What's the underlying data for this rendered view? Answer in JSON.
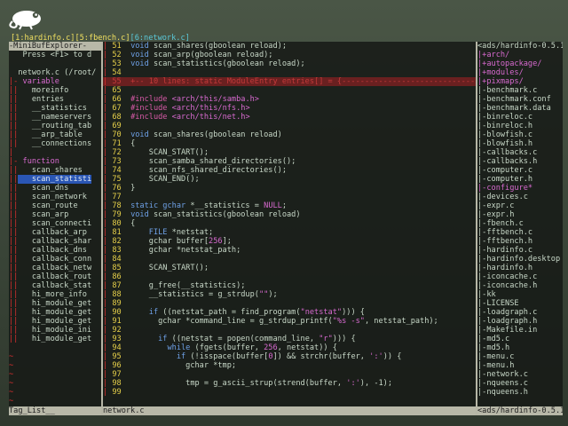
{
  "buffer_tabs": {
    "items": [
      "[1:hardinfo.c]",
      "[5:fbench.c]",
      "[6:network.c]"
    ]
  },
  "left_pane": {
    "title": "-MiniBufExplorer-",
    "lines": [
      {
        "gut": "",
        "text": " Press <F1> to d",
        "cls": "txt"
      },
      {
        "gut": "",
        "text": "",
        "cls": "txt"
      },
      {
        "gut": "",
        "text": "network.c (/root/",
        "cls": "txt"
      },
      {
        "gut": "|-",
        "text": " variable",
        "cls": "magenta"
      },
      {
        "gut": "||",
        "text": "   moreinfo",
        "cls": "txt"
      },
      {
        "gut": "||",
        "text": "   entries",
        "cls": "txt"
      },
      {
        "gut": "||",
        "text": "   __statistics",
        "cls": "txt"
      },
      {
        "gut": "||",
        "text": "   __nameservers",
        "cls": "txt"
      },
      {
        "gut": "||",
        "text": "   __routing_tab",
        "cls": "txt"
      },
      {
        "gut": "||",
        "text": "   __arp_table",
        "cls": "txt"
      },
      {
        "gut": "||",
        "text": "   __connections",
        "cls": "txt"
      },
      {
        "gut": "|",
        "text": "",
        "cls": "txt"
      },
      {
        "gut": "|-",
        "text": " function",
        "cls": "magenta"
      },
      {
        "gut": "||",
        "text": "   scan_shares",
        "cls": "txt"
      },
      {
        "gut": "||",
        "text": "   scan_statisti",
        "cls": "sel"
      },
      {
        "gut": "||",
        "text": "   scan_dns",
        "cls": "txt"
      },
      {
        "gut": "||",
        "text": "   scan_network",
        "cls": "txt"
      },
      {
        "gut": "||",
        "text": "   scan_route",
        "cls": "txt"
      },
      {
        "gut": "||",
        "text": "   scan_arp",
        "cls": "txt"
      },
      {
        "gut": "||",
        "text": "   scan_connecti",
        "cls": "txt"
      },
      {
        "gut": "||",
        "text": "   callback_arp",
        "cls": "txt"
      },
      {
        "gut": "||",
        "text": "   callback_shar",
        "cls": "txt"
      },
      {
        "gut": "||",
        "text": "   callback_dns",
        "cls": "txt"
      },
      {
        "gut": "||",
        "text": "   callback_conn",
        "cls": "txt"
      },
      {
        "gut": "||",
        "text": "   callback_netw",
        "cls": "txt"
      },
      {
        "gut": "||",
        "text": "   callback_rout",
        "cls": "txt"
      },
      {
        "gut": "||",
        "text": "   callback_stat",
        "cls": "txt"
      },
      {
        "gut": "||",
        "text": "   hi_more_info",
        "cls": "txt"
      },
      {
        "gut": "||",
        "text": "   hi_module_get",
        "cls": "txt"
      },
      {
        "gut": "||",
        "text": "   hi_module_get",
        "cls": "txt"
      },
      {
        "gut": "||",
        "text": "   hi_module_get",
        "cls": "txt"
      },
      {
        "gut": "||",
        "text": "   hi_module_ini",
        "cls": "txt"
      },
      {
        "gut": "||",
        "text": "   hi_module_get",
        "cls": "txt"
      },
      {
        "gut": "",
        "text": "",
        "cls": "txt"
      },
      {
        "gut": "~",
        "text": "",
        "cls": "txt"
      },
      {
        "gut": "~",
        "text": "",
        "cls": "txt"
      },
      {
        "gut": "~",
        "text": "",
        "cls": "txt"
      },
      {
        "gut": "~",
        "text": "",
        "cls": "txt"
      },
      {
        "gut": "~",
        "text": "",
        "cls": "txt"
      },
      {
        "gut": "~",
        "text": "",
        "cls": "txt"
      },
      {
        "gut": "~",
        "text": "",
        "cls": "txt"
      }
    ],
    "status": "Tag_List__"
  },
  "code_pane": {
    "lines": [
      {
        "n": "51",
        "segs": [
          [
            "kw",
            "void "
          ],
          [
            "txt",
            "scan_shares(gboolean reload);"
          ]
        ]
      },
      {
        "n": "52",
        "segs": [
          [
            "kw",
            "void "
          ],
          [
            "txt",
            "scan_arp(gboolean reload);"
          ]
        ]
      },
      {
        "n": "53",
        "segs": [
          [
            "kw",
            "void "
          ],
          [
            "txt",
            "scan_statistics(gboolean reload);"
          ]
        ]
      },
      {
        "n": "54",
        "segs": []
      },
      {
        "n": "55",
        "segs": [
          [
            "red",
            "+-- 10 lines: static ModuleEntry entries[] = {-------------------------------------------"
          ]
        ],
        "fold": true
      },
      {
        "n": "65",
        "segs": []
      },
      {
        "n": "66",
        "segs": [
          [
            "pp",
            "#include "
          ],
          [
            "inc",
            "<arch/this/samba.h>"
          ]
        ]
      },
      {
        "n": "67",
        "segs": [
          [
            "pp",
            "#include "
          ],
          [
            "inc",
            "<arch/this/nfs.h>"
          ]
        ]
      },
      {
        "n": "68",
        "segs": [
          [
            "pp",
            "#include "
          ],
          [
            "inc",
            "<arch/this/net.h>"
          ]
        ]
      },
      {
        "n": "69",
        "segs": []
      },
      {
        "n": "70",
        "segs": [
          [
            "kw",
            "void "
          ],
          [
            "txt",
            "scan_shares(gboolean reload)"
          ]
        ]
      },
      {
        "n": "71",
        "segs": [
          [
            "txt",
            "{"
          ]
        ]
      },
      {
        "n": "72",
        "segs": [
          [
            "txt",
            "    SCAN_START();"
          ]
        ]
      },
      {
        "n": "73",
        "segs": [
          [
            "txt",
            "    scan_samba_shared_directories();"
          ]
        ]
      },
      {
        "n": "74",
        "segs": [
          [
            "txt",
            "    scan_nfs_shared_directories();"
          ]
        ]
      },
      {
        "n": "75",
        "segs": [
          [
            "txt",
            "    SCAN_END();"
          ]
        ]
      },
      {
        "n": "76",
        "segs": [
          [
            "txt",
            "}"
          ]
        ]
      },
      {
        "n": "77",
        "segs": []
      },
      {
        "n": "78",
        "segs": [
          [
            "kw",
            "static "
          ],
          [
            "kw",
            "gchar "
          ],
          [
            "txt",
            "*__statistics = "
          ],
          [
            "num",
            "NULL"
          ],
          [
            "txt",
            ";"
          ]
        ]
      },
      {
        "n": "79",
        "segs": [
          [
            "kw",
            "void "
          ],
          [
            "txt",
            "scan_statistics(gboolean reload)"
          ]
        ]
      },
      {
        "n": "80",
        "segs": [
          [
            "txt",
            "{"
          ]
        ]
      },
      {
        "n": "81",
        "segs": [
          [
            "kw",
            "    FILE "
          ],
          [
            "txt",
            "*netstat;"
          ]
        ]
      },
      {
        "n": "82",
        "segs": [
          [
            "txt",
            "    gchar buffer["
          ],
          [
            "num",
            "256"
          ],
          [
            "txt",
            "];"
          ]
        ]
      },
      {
        "n": "83",
        "segs": [
          [
            "txt",
            "    gchar *netstat_path;"
          ]
        ]
      },
      {
        "n": "84",
        "segs": []
      },
      {
        "n": "85",
        "segs": [
          [
            "txt",
            "    SCAN_START();"
          ]
        ]
      },
      {
        "n": "86",
        "segs": []
      },
      {
        "n": "87",
        "segs": [
          [
            "txt",
            "    g_free(__statistics);"
          ]
        ]
      },
      {
        "n": "88",
        "segs": [
          [
            "txt",
            "    __statistics = g_strdup("
          ],
          [
            "str",
            "\"\""
          ],
          [
            "txt",
            ");"
          ]
        ]
      },
      {
        "n": "89",
        "segs": []
      },
      {
        "n": "90",
        "segs": [
          [
            "kw",
            "    if "
          ],
          [
            "txt",
            "((netstat_path = find_program("
          ],
          [
            "str",
            "\"netstat\""
          ],
          [
            "txt",
            "))) {"
          ]
        ]
      },
      {
        "n": "91",
        "segs": [
          [
            "txt",
            "      gchar *command_line = g_strdup_printf("
          ],
          [
            "str",
            "\"%s -s\""
          ],
          [
            "txt",
            ", netstat_path);"
          ]
        ]
      },
      {
        "n": "92",
        "segs": []
      },
      {
        "n": "93",
        "segs": [
          [
            "kw",
            "      if "
          ],
          [
            "txt",
            "((netstat = popen(command_line, "
          ],
          [
            "str",
            "\"r\""
          ],
          [
            "txt",
            "))) {"
          ]
        ]
      },
      {
        "n": "94",
        "segs": [
          [
            "kw",
            "        while "
          ],
          [
            "txt",
            "(fgets(buffer, "
          ],
          [
            "num",
            "256"
          ],
          [
            "txt",
            ", netstat)) {"
          ]
        ]
      },
      {
        "n": "95",
        "segs": [
          [
            "kw",
            "          if "
          ],
          [
            "txt",
            "(!isspace(buffer["
          ],
          [
            "num",
            "0"
          ],
          [
            "txt",
            "]) && strchr(buffer, "
          ],
          [
            "str",
            "':'"
          ],
          [
            "txt",
            ")) {"
          ]
        ]
      },
      {
        "n": "96",
        "segs": [
          [
            "txt",
            "            gchar *tmp;"
          ]
        ]
      },
      {
        "n": "97",
        "segs": []
      },
      {
        "n": "98",
        "segs": [
          [
            "txt",
            "            tmp = g_ascii_strup(strend(buffer, "
          ],
          [
            "str",
            "':'"
          ],
          [
            "txt",
            "), -1);"
          ]
        ]
      },
      {
        "n": "99",
        "segs": []
      }
    ],
    "status": "network.c"
  },
  "right_pane": {
    "lines": [
      {
        "text": "<ads/hardinfo-0.5.1/",
        "cls": "txt"
      },
      {
        "text": "|+arch/",
        "cls": "magenta"
      },
      {
        "text": "|+autopackage/",
        "cls": "magenta"
      },
      {
        "text": "|+modules/",
        "cls": "magenta"
      },
      {
        "text": "|+pixmaps/",
        "cls": "magenta"
      },
      {
        "text": "|-benchmark.c",
        "cls": "txt"
      },
      {
        "text": "|-benchmark.conf",
        "cls": "txt"
      },
      {
        "text": "|-benchmark.data",
        "cls": "txt"
      },
      {
        "text": "|-binreloc.c",
        "cls": "txt"
      },
      {
        "text": "|-binreloc.h",
        "cls": "txt"
      },
      {
        "text": "|-blowfish.c",
        "cls": "txt"
      },
      {
        "text": "|-blowfish.h",
        "cls": "txt"
      },
      {
        "text": "|-callbacks.c",
        "cls": "txt"
      },
      {
        "text": "|-callbacks.h",
        "cls": "txt"
      },
      {
        "text": "|-computer.c",
        "cls": "txt"
      },
      {
        "text": "|-computer.h",
        "cls": "txt"
      },
      {
        "text": "|-configure*",
        "cls": "magenta"
      },
      {
        "text": "|-devices.c",
        "cls": "txt"
      },
      {
        "text": "|-expr.c",
        "cls": "txt"
      },
      {
        "text": "|-expr.h",
        "cls": "txt"
      },
      {
        "text": "|-fbench.c",
        "cls": "txt"
      },
      {
        "text": "|-fftbench.c",
        "cls": "txt"
      },
      {
        "text": "|-fftbench.h",
        "cls": "txt"
      },
      {
        "text": "|-hardinfo.c",
        "cls": "txt"
      },
      {
        "text": "|-hardinfo.desktop",
        "cls": "txt"
      },
      {
        "text": "|-hardinfo.h",
        "cls": "txt"
      },
      {
        "text": "|-iconcache.c",
        "cls": "txt"
      },
      {
        "text": "|-iconcache.h",
        "cls": "txt"
      },
      {
        "text": "|-kk",
        "cls": "txt"
      },
      {
        "text": "|-LICENSE",
        "cls": "txt"
      },
      {
        "text": "|-loadgraph.c",
        "cls": "txt"
      },
      {
        "text": "|-loadgraph.h",
        "cls": "txt"
      },
      {
        "text": "|-Makefile.in",
        "cls": "txt"
      },
      {
        "text": "|-md5.c",
        "cls": "txt"
      },
      {
        "text": "|-md5.h",
        "cls": "txt"
      },
      {
        "text": "|-menu.c",
        "cls": "txt"
      },
      {
        "text": "|-menu.h",
        "cls": "txt"
      },
      {
        "text": "|-network.c",
        "cls": "txt"
      },
      {
        "text": "|-nqueens.c",
        "cls": "txt"
      },
      {
        "text": "|-nqueens.h",
        "cls": "txt"
      }
    ],
    "status": "<ads/hardinfo-0.5.1"
  }
}
